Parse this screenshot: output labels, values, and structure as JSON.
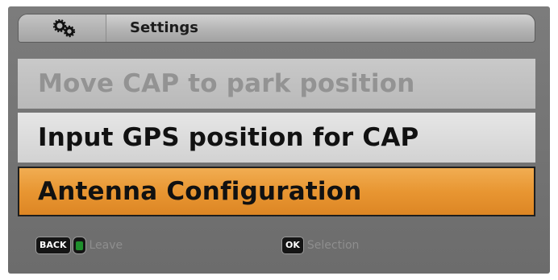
{
  "header": {
    "icon": "gears-icon",
    "title": "Settings"
  },
  "menu": {
    "items": [
      {
        "label": "Move CAP to park position",
        "state": "disabled"
      },
      {
        "label": "Input GPS position for CAP",
        "state": "normal"
      },
      {
        "label": "Antenna Configuration",
        "state": "selected"
      }
    ]
  },
  "footer": {
    "back_key": "BACK",
    "leave_label": "Leave",
    "ok_key": "OK",
    "selection_label": "Selection"
  },
  "colors": {
    "selected_highlight": "#e89632",
    "green_key": "#1e8f2c"
  }
}
